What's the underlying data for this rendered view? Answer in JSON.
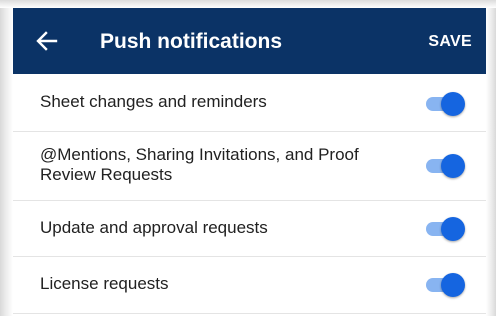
{
  "header": {
    "title": "Push notifications",
    "save_label": "SAVE",
    "back_icon": "arrow-left-icon"
  },
  "settings": [
    {
      "label": "Sheet changes and reminders",
      "enabled": true
    },
    {
      "label": "@Mentions, Sharing Invitations, and Proof Review Requests",
      "enabled": true
    },
    {
      "label": "Update and approval requests",
      "enabled": true
    },
    {
      "label": "License requests",
      "enabled": true
    }
  ],
  "colors": {
    "appbar": "#0b3366",
    "toggle_thumb_on": "#1565e0",
    "toggle_track_on": "#88b4f1"
  }
}
